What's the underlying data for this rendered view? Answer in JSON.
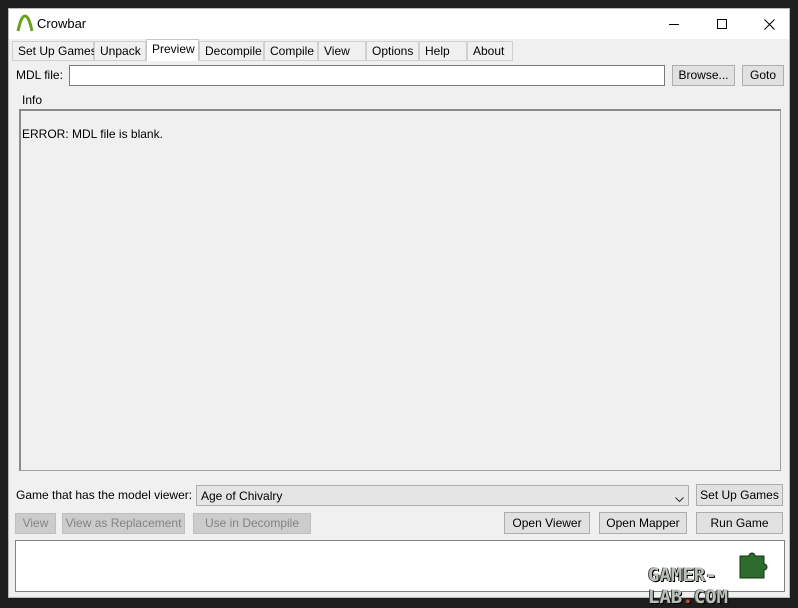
{
  "window": {
    "title": "Crowbar"
  },
  "tabs": [
    {
      "label": "Set Up Games",
      "active": false
    },
    {
      "label": "Unpack",
      "active": false
    },
    {
      "label": "Preview",
      "active": true
    },
    {
      "label": "Decompile",
      "active": false
    },
    {
      "label": "Compile",
      "active": false
    },
    {
      "label": "View",
      "active": false
    },
    {
      "label": "Options",
      "active": false
    },
    {
      "label": "Help",
      "active": false
    },
    {
      "label": "About",
      "active": false
    }
  ],
  "mdl": {
    "label": "MDL file:",
    "value": "",
    "browse_label": "Browse...",
    "goto_label": "Goto"
  },
  "info": {
    "title": "Info",
    "message": "ERROR: MDL file is blank."
  },
  "viewer": {
    "label": "Game that has the model viewer:",
    "selected_game": "Age of Chivalry",
    "setup_games_label": "Set Up Games"
  },
  "actions": {
    "view_label": "View",
    "view_replacement_label": "View as Replacement",
    "use_in_decompile_label": "Use in Decompile",
    "open_viewer_label": "Open Viewer",
    "open_mapper_label": "Open Mapper",
    "run_game_label": "Run Game"
  },
  "watermark": {
    "text_left": "GAMER-LAB",
    "text_dot": ".",
    "text_right": "COM"
  },
  "colors": {
    "icon_green": "#6aa121",
    "window_bg": "#f0f0f0"
  }
}
